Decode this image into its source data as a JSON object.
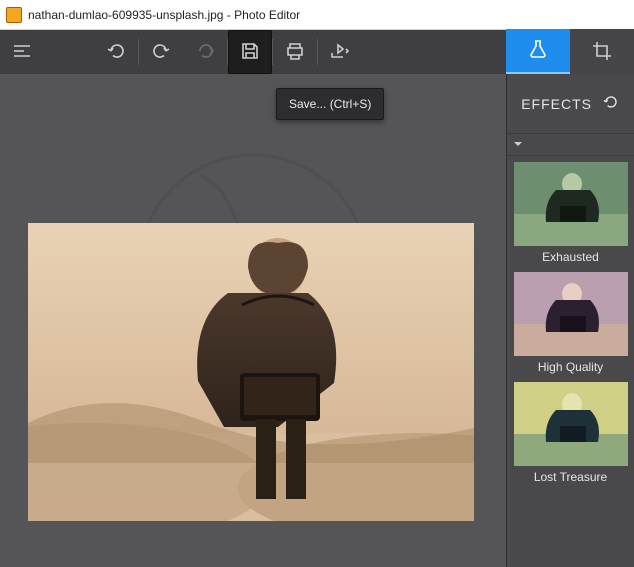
{
  "window": {
    "title": "nathan-dumlao-609935-unsplash.jpg - Photo Editor"
  },
  "toolbar": {
    "menu_icon": "menu-icon",
    "undo_icon": "undo-icon",
    "redo_icon": "redo-icon",
    "redo2_icon": "redo-forward-icon",
    "save_icon": "save-icon",
    "print_icon": "print-icon",
    "share_icon": "share-icon"
  },
  "tooltip": {
    "save": "Save... (Ctrl+S)"
  },
  "rightTabs": {
    "effects_icon": "flask-icon",
    "crop_icon": "crop-icon"
  },
  "panel": {
    "heading": "EFFECTS",
    "reset_icon": "undo-small-icon",
    "effects": [
      {
        "label": "Exhausted"
      },
      {
        "label": "High Quality"
      },
      {
        "label": "Lost Treasure"
      }
    ]
  }
}
